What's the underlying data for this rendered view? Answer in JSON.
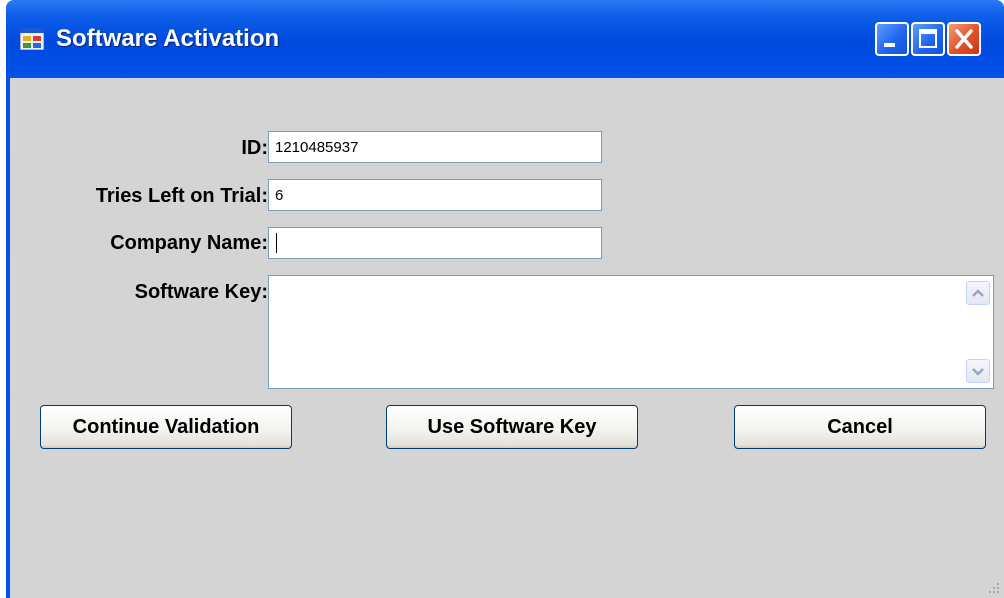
{
  "window": {
    "title": "Software Activation",
    "controls": {
      "minimize": "minimize-icon",
      "maximize": "maximize-icon",
      "close": "close-icon"
    }
  },
  "form": {
    "id_label": "ID:",
    "id_value": "1210485937",
    "tries_label": "Tries Left on Trial:",
    "tries_value": "6",
    "company_label": "Company Name:",
    "company_value": "",
    "key_label": "Software Key:",
    "key_value": ""
  },
  "buttons": {
    "continue_label": "Continue Validation",
    "use_key_label": "Use Software Key",
    "cancel_label": "Cancel"
  },
  "colors": {
    "titlebar": "#0050ee",
    "client": "#d4d4d4",
    "field_border": "#7f9db9",
    "close": "#e0502a"
  }
}
